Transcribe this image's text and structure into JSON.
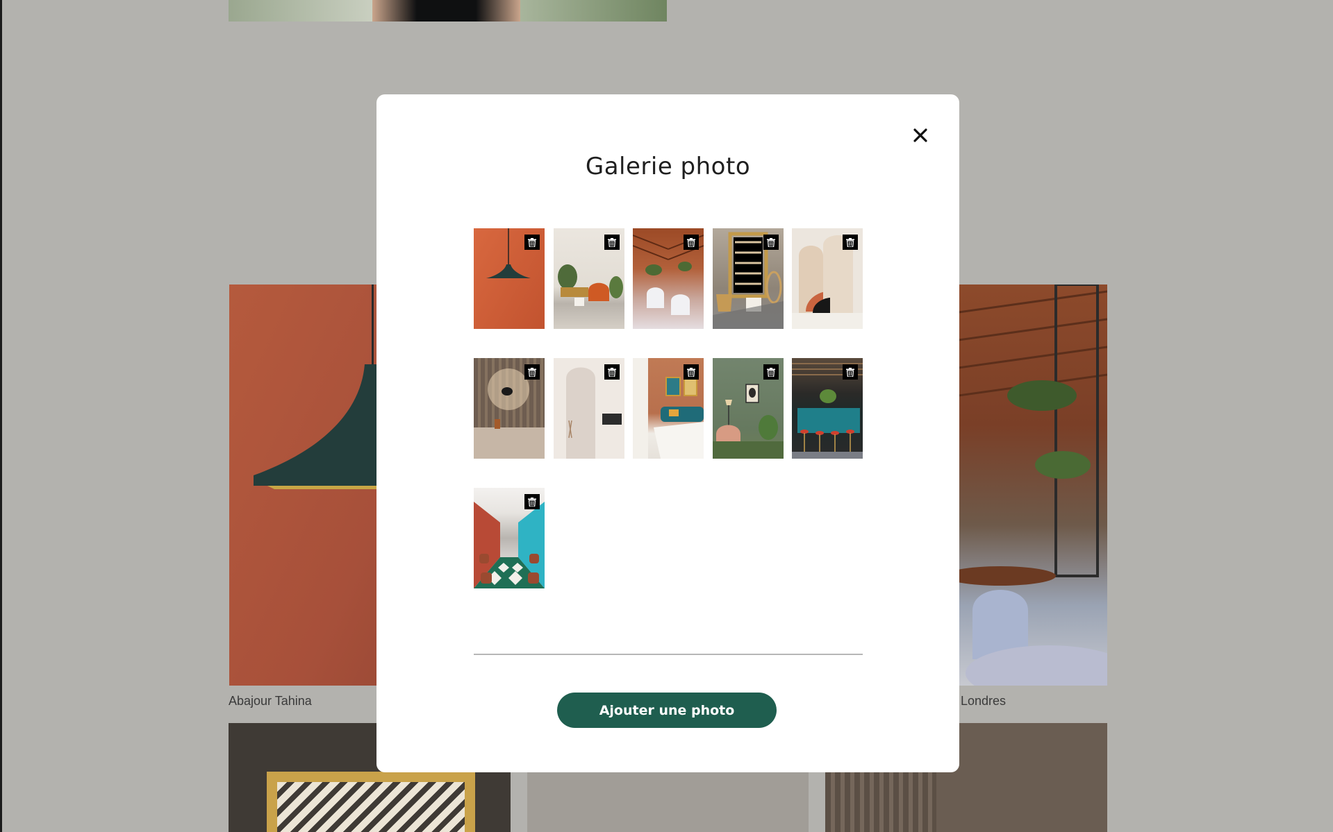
{
  "modal": {
    "title": "Galerie photo",
    "add_button_label": "Ajouter une photo",
    "close_icon": "close-icon",
    "delete_icon": "trash-icon"
  },
  "gallery": {
    "photos": [
      {
        "subject": "orange wall with black pendant lamp"
      },
      {
        "subject": "living room with orange armchair and plants"
      },
      {
        "subject": "restaurant under wooden roof with white chairs"
      },
      {
        "subject": "mirror with wooden frame and armchair"
      },
      {
        "subject": "arched beige panels with black shapes"
      },
      {
        "subject": "wood panelled wall with wall lamp"
      },
      {
        "subject": "white minimalist room with bench"
      },
      {
        "subject": "bedroom with terracotta wall and teal headboard"
      },
      {
        "subject": "green room with armchair and lamp"
      },
      {
        "subject": "bar with teal counter and red stools"
      },
      {
        "subject": "long dining hall with checkered floor"
      }
    ]
  },
  "background": {
    "captions": [
      "Abajour Tahina",
      "Londres"
    ]
  },
  "colors": {
    "overlay": "#b3b2ae",
    "primary_button": "#1f5e4f"
  }
}
